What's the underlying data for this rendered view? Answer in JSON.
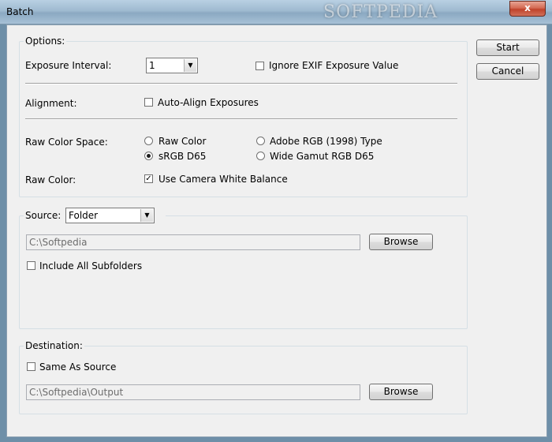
{
  "window": {
    "title": "Batch",
    "watermark": "SOFTPEDIA",
    "close_label": "x"
  },
  "buttons": {
    "start": "Start",
    "cancel": "Cancel"
  },
  "options": {
    "label": "Options:",
    "exposure_interval": {
      "label": "Exposure Interval:",
      "value": "1"
    },
    "ignore_exif": {
      "label": "Ignore EXIF Exposure Value",
      "checked": false
    },
    "alignment": {
      "label": "Alignment:",
      "auto_align": {
        "label": "Auto-Align Exposures",
        "checked": false
      }
    },
    "raw_color_space": {
      "label": "Raw Color Space:",
      "choices": [
        {
          "label": "Raw Color",
          "selected": false
        },
        {
          "label": "Adobe RGB (1998) Type",
          "selected": false
        },
        {
          "label": "sRGB D65",
          "selected": true
        },
        {
          "label": "Wide Gamut RGB D65",
          "selected": false
        }
      ]
    },
    "raw_color": {
      "label": "Raw Color:",
      "camera_wb": {
        "label": "Use Camera White Balance",
        "checked": true
      }
    }
  },
  "source": {
    "label": "Source:",
    "type": "Folder",
    "path": "C:\\Softpedia",
    "browse": "Browse",
    "include_subfolders": {
      "label": "Include All Subfolders",
      "checked": false
    }
  },
  "destination": {
    "label": "Destination:",
    "same_as_source": {
      "label": "Same As Source",
      "checked": false
    },
    "path": "C:\\Softpedia\\Output",
    "browse": "Browse"
  }
}
